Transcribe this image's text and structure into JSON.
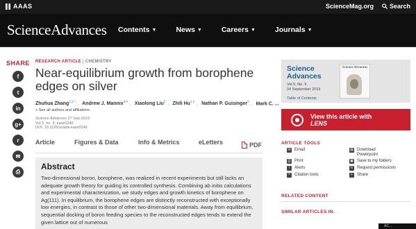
{
  "topbar": {
    "aaas": "AAAS",
    "site": "ScienceMag.org",
    "search": "Search"
  },
  "brand": "ScienceAdvances",
  "nav": [
    {
      "label": "Contents"
    },
    {
      "label": "News"
    },
    {
      "label": "Careers"
    },
    {
      "label": "Journals"
    }
  ],
  "share": {
    "title": "SHARE",
    "buttons": [
      "f",
      "t",
      "in",
      "g+",
      "r",
      "✉",
      "⎙"
    ]
  },
  "article": {
    "type": "RESEARCH ARTICLE",
    "subject": "CHEMISTRY",
    "title": "Near-equilibrium growth from borophene edges on silver",
    "authors": [
      {
        "name": "Zhuhua Zhang",
        "sup": "1,2,*"
      },
      {
        "name": "Andrew J. Mannix",
        "sup": "3,4"
      },
      {
        "name": "Xiaolong Liu",
        "sup": "5"
      },
      {
        "name": "Zhili Hu",
        "sup": "1,2"
      },
      {
        "name": "Nathan P. Guisinger",
        "sup": "3"
      },
      {
        "name": "Mark C. ...",
        "sup": ""
      }
    ],
    "see_all": "+ See all authors and affiliations",
    "journal": "Science Advances",
    "date": "27 Sep 2019:",
    "volume": "Vol 5, no. 9, eaax0246",
    "doi": "DOI: 10.1126/sciadv.eaax0246"
  },
  "tabs": {
    "article": "Article",
    "figures": "Figures & Data",
    "metrics": "Info & Metrics",
    "eletters": "eLetters",
    "pdf": "PDF"
  },
  "abstract": {
    "title": "Abstract",
    "text": "Two-dimensional boron, borophene, was realized in recent experiments but still lacks an adequate growth theory for guiding its controlled synthesis. Combining ab initio calculations and experimental characterization, we study edges and growth kinetics of borophene on Ag(111). In equilibrium, the borophene edges are distinctly reconstructed with exceptionally low energies, in contrast to those of other two-dimensional materials. Away from equilibrium, sequential docking of boron feeding species to the reconstructed edges tends to extend the given lattice out of numerous"
  },
  "issue": {
    "journal_line1": "Science",
    "journal_line2": "Advances",
    "volume": "Vol 5, No. 9",
    "date": "04 September 2019",
    "toc": "Table of Contents",
    "cover_title": "Science Advances"
  },
  "lens": {
    "line1": "View this article with",
    "word": "LENS"
  },
  "tools": {
    "title": "ARTICLE TOOLS",
    "items": [
      {
        "label": "Email",
        "icon": "✉"
      },
      {
        "label": "Download Powerpoint",
        "icon": "▤"
      },
      {
        "label": "Print",
        "icon": "⎙"
      },
      {
        "label": "Save to my folders",
        "icon": "▣"
      },
      {
        "label": "Alerts",
        "icon": "!"
      },
      {
        "label": "Request permissions",
        "icon": "©"
      },
      {
        "label": "Citation tools",
        "icon": "❝"
      },
      {
        "label": "Share",
        "icon": "+"
      }
    ]
  },
  "related": "RELATED CONTENT",
  "similar": "SIMILAR ARTICLES IN:",
  "taskbar": "AC..."
}
